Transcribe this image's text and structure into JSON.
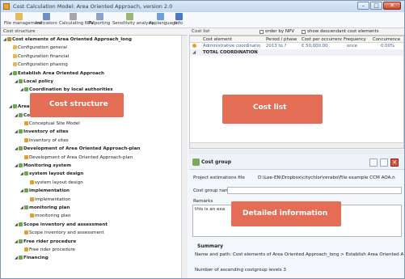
{
  "window": {
    "title": "Cost Calculation Model: Area Oriented Approach, version 2.0",
    "buttons": {
      "minimize": "–",
      "maximize": "□",
      "close": "✕"
    }
  },
  "toolbar": {
    "items": [
      {
        "label": "File management",
        "icon": "folder-icon",
        "color": "#e2bb56"
      },
      {
        "label": "Indicators",
        "icon": "indicators-icon",
        "color": "#6d8fc6"
      },
      {
        "label": "Calculating NPV",
        "icon": "calculator-icon",
        "color": "#a7a7a7"
      },
      {
        "label": "Reporting",
        "icon": "report-icon",
        "color": "#8aa4c8"
      },
      {
        "label": "Sensitivity analysis",
        "icon": "sensitivity-icon",
        "color": "#9cb870"
      },
      {
        "label": "Applanguage",
        "icon": "language-icon",
        "color": "#6f9fd8"
      },
      {
        "label": "Info",
        "icon": "info-icon",
        "color": "#4a78c2"
      }
    ]
  },
  "left_pane": {
    "header": "Cost structure",
    "tree": [
      {
        "text": "Cost elements of Area Oriented Approach_long",
        "indent": 0,
        "icon": "root",
        "bold": true,
        "arrow": "◢"
      },
      {
        "text": "Configuration general",
        "indent": 1,
        "icon": "folder",
        "bold": false,
        "arrow": ""
      },
      {
        "text": "Configuration financial",
        "indent": 1,
        "icon": "folder",
        "bold": false,
        "arrow": ""
      },
      {
        "text": "Configuration phasing",
        "indent": 1,
        "icon": "folder",
        "bold": false,
        "arrow": ""
      },
      {
        "text": "Establish Area Oriented Approach",
        "indent": 1,
        "icon": "node",
        "bold": true,
        "arrow": "◢"
      },
      {
        "text": "Local policy",
        "indent": 2,
        "icon": "node",
        "bold": true,
        "arrow": "◢"
      },
      {
        "text": "Coordination by local authorities",
        "indent": 3,
        "icon": "node",
        "bold": true,
        "arrow": "◢"
      },
      {
        "text": "Administrative coordination",
        "indent": 4,
        "icon": "euro",
        "bold": false,
        "arrow": ""
      },
      {
        "text": "Area Oriented Approach-plan",
        "indent": 1,
        "icon": "node",
        "bold": true,
        "arrow": "◢"
      },
      {
        "text": "Conceptual Site Model",
        "indent": 2,
        "icon": "node",
        "bold": true,
        "arrow": "◢"
      },
      {
        "text": "Conceptual Site Model",
        "indent": 3,
        "icon": "euro",
        "bold": false,
        "arrow": ""
      },
      {
        "text": "Inventory of sites",
        "indent": 2,
        "icon": "node",
        "bold": true,
        "arrow": "◢"
      },
      {
        "text": "Inventory of sites",
        "indent": 3,
        "icon": "euro",
        "bold": false,
        "arrow": ""
      },
      {
        "text": "Development of Area Oriented Approach-plan",
        "indent": 2,
        "icon": "node",
        "bold": true,
        "arrow": "◢"
      },
      {
        "text": "Development of Area Oriented Approach-plan",
        "indent": 3,
        "icon": "euro",
        "bold": false,
        "arrow": ""
      },
      {
        "text": "Monitoring system",
        "indent": 2,
        "icon": "node",
        "bold": true,
        "arrow": "◢"
      },
      {
        "text": "system layout design",
        "indent": 3,
        "icon": "node",
        "bold": true,
        "arrow": "◢"
      },
      {
        "text": "system layout design",
        "indent": 4,
        "icon": "euro",
        "bold": false,
        "arrow": ""
      },
      {
        "text": "implementation",
        "indent": 3,
        "icon": "node",
        "bold": true,
        "arrow": "◢"
      },
      {
        "text": "implementation",
        "indent": 4,
        "icon": "euro",
        "bold": false,
        "arrow": ""
      },
      {
        "text": "monitoring plan",
        "indent": 3,
        "icon": "node",
        "bold": true,
        "arrow": "◢"
      },
      {
        "text": "monitoring plan",
        "indent": 4,
        "icon": "euro",
        "bold": false,
        "arrow": ""
      },
      {
        "text": "Scope inventory and assessment",
        "indent": 2,
        "icon": "node",
        "bold": true,
        "arrow": "◢"
      },
      {
        "text": "Scope inventory and assessment",
        "indent": 3,
        "icon": "euro",
        "bold": false,
        "arrow": ""
      },
      {
        "text": "Free rider procedure",
        "indent": 2,
        "icon": "node",
        "bold": true,
        "arrow": "◢"
      },
      {
        "text": "Free rider procedure",
        "indent": 3,
        "icon": "euro",
        "bold": false,
        "arrow": ""
      },
      {
        "text": "Financing",
        "indent": 2,
        "icon": "node",
        "bold": true,
        "arrow": "◢"
      }
    ]
  },
  "cost_list": {
    "header": "Cost list",
    "order_by_npv": "order by NPV",
    "show_descendants": "show descendant cost elements",
    "columns": [
      "Cost element",
      "Period / phase",
      "Cost per occurrence",
      "Frequency",
      "Concurrence"
    ],
    "rows": [
      {
        "icon": "euro",
        "cells": [
          "Administrative coordinatio",
          "2013 to ?",
          "€ 50,000.00",
          "once",
          "0.00%"
        ]
      }
    ],
    "total_label": "TOTAL COORDINATION"
  },
  "cost_group": {
    "title": "Cost group",
    "fields": [
      {
        "label": "Project estimations file",
        "value": "D:\\Lee-EN\\Dropbox\\citychlor\\rerabo\\File example CCM AOA.n"
      },
      {
        "label": "Cost group name",
        "value": ""
      },
      {
        "label": "Remarks",
        "value": ""
      }
    ],
    "remarks_text": "this is an exa",
    "summary_title": "Summary",
    "summary_lines": [
      "Name and path: Cost elements of Area Oriented Approach_long > Establish Area Oriented A",
      "Number of ascending costgroup levels 3"
    ]
  },
  "annotations": {
    "cost_structure": "Cost structure",
    "cost_list": "Cost list",
    "detailed_information": "Detailed information"
  }
}
